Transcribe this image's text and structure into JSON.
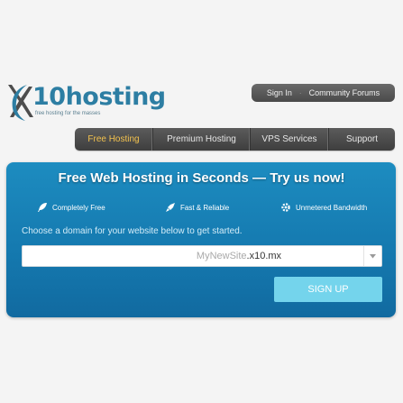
{
  "header": {
    "logo": {
      "text": "10hosting",
      "tagline": "free hosting for the masses"
    },
    "top_links": [
      {
        "label": "Sign In"
      },
      {
        "label": "Community Forums"
      }
    ],
    "top_separator": "·"
  },
  "nav": {
    "items": [
      {
        "label": "Free Hosting",
        "active": true
      },
      {
        "label": "Premium Hosting",
        "active": false
      },
      {
        "label": "VPS Services",
        "active": false
      },
      {
        "label": "Support",
        "active": false
      }
    ]
  },
  "hero": {
    "title": "Free Web Hosting in Seconds — Try us now!",
    "features": [
      {
        "icon": "feather-icon",
        "label": "Completely Free"
      },
      {
        "icon": "rocket-icon",
        "label": "Fast & Reliable"
      },
      {
        "icon": "gear-icon",
        "label": "Unmetered Bandwidth"
      }
    ],
    "prompt": "Choose a domain for your website below to get started.",
    "domain": {
      "placeholder": "MyNewSite",
      "selected_domain": ".x10.mx"
    },
    "signup_label": "SIGN UP"
  },
  "colors": {
    "brand_blue": "#2d7ea3",
    "hero_blue": "#1784b8",
    "nav_active": "#f3c24e",
    "signup": "#74d4ec"
  }
}
